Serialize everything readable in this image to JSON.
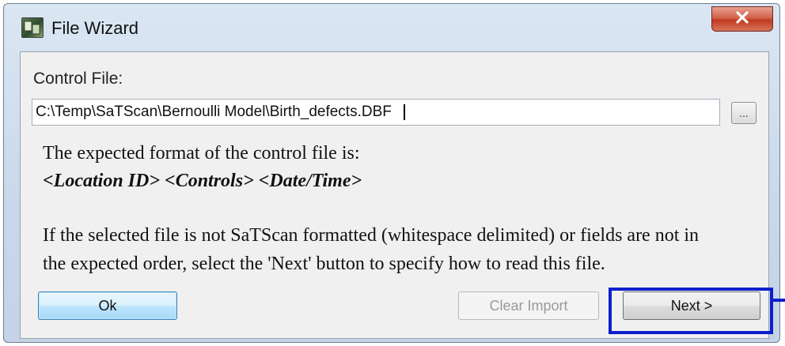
{
  "window": {
    "title": "File Wizard",
    "close_glyph": "x"
  },
  "control_file": {
    "label": "Control File:",
    "path_value": "C:\\Temp\\SaTScan\\Bernoulli Model\\Birth_defects.DBF",
    "browse_label": "..."
  },
  "format_info": {
    "line1": "The expected format of the control file is:",
    "format": "<Location ID> <Controls> <Date/Time>"
  },
  "help_text": {
    "line1": "If the selected file is not SaTScan formatted (whitespace delimited) or fields are not in",
    "line2": "the expected order, select the 'Next' button to specify how to read this file."
  },
  "buttons": {
    "ok": "Ok",
    "clear_import": "Clear Import",
    "next": "Next >"
  },
  "colors": {
    "highlight": "#0c1fcc",
    "close_button": "#c7402a"
  },
  "icons": {
    "app": "file-wizard-icon",
    "close": "close-icon"
  }
}
